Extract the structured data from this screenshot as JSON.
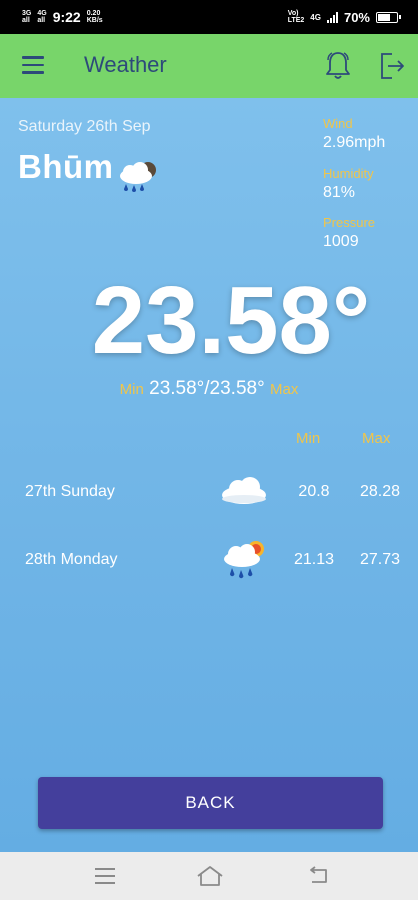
{
  "status_bar": {
    "net_top": "3G",
    "net_bottom": "all",
    "net2_top": "4G",
    "net2_bottom": "all",
    "time": "9:22",
    "speed_value": "0.20",
    "speed_unit": "KB/s",
    "volte_top": "Vo)",
    "volte_bottom": "LTE2",
    "net3": "4G",
    "battery_percent": "70%",
    "battery_level": 0.7
  },
  "app_bar": {
    "title": "Weather",
    "menu_icon": "hamburger-menu-icon",
    "bell_icon": "notification-bell-icon",
    "logout_icon": "logout-icon"
  },
  "current": {
    "date": "Saturday 26th Sep",
    "city": "Bhūm",
    "condition_icon": "rain-cloud-icon",
    "wind_label": "Wind",
    "wind_value": "2.96mph",
    "humidity_label": "Humidity",
    "humidity_value": "81%",
    "pressure_label": "Pressure",
    "pressure_value": "1009",
    "temperature": "23.58°",
    "min_label": "Min",
    "min_max_value": "23.58°/23.58°",
    "max_label": "Max"
  },
  "forecast": {
    "min_header": "Min",
    "max_header": "Max",
    "days": [
      {
        "day": "27th Sunday",
        "icon": "cloud-icon",
        "min": "20.8",
        "max": "28.28"
      },
      {
        "day": "28th Monday",
        "icon": "sun-rain-cloud-icon",
        "min": "21.13",
        "max": "27.73"
      }
    ]
  },
  "back_button": "BACK",
  "colors": {
    "app_bar": "#78d56a",
    "accent_yellow": "#f0c54a",
    "button": "#443f9c",
    "title_text": "#2d4a7a"
  }
}
